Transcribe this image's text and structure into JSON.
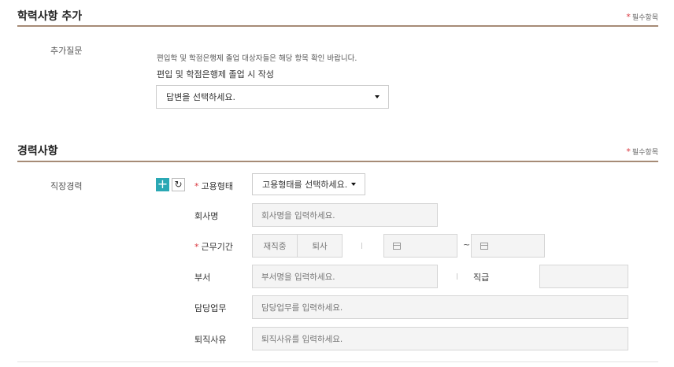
{
  "education": {
    "title": "학력사항 추가",
    "required_note": "필수항목",
    "question_label": "추가질문",
    "help_text": "편입학 및 학점은행제 졸업 대상자들은 해당 항목 확인 바랍니다.",
    "sub_label": "편입 및 학점은행제 졸업 시 작성",
    "answer_select": "답변을 선택하세요."
  },
  "career": {
    "title": "경력사항",
    "required_note": "필수항목",
    "row_label": "직장경력",
    "add_icon": "plus-icon",
    "reset_icon": "refresh-icon",
    "employment_type": {
      "label": "고용형태",
      "select": "고용형태를 선택하세요."
    },
    "company": {
      "label": "회사명",
      "placeholder": "회사명을 입력하세요."
    },
    "period": {
      "label": "근무기간",
      "employed": "재직중",
      "resigned": "퇴사",
      "separator": "~"
    },
    "department": {
      "label": "부서",
      "placeholder": "부서명을 입력하세요."
    },
    "position": {
      "label": "직급"
    },
    "duty": {
      "label": "담당업무",
      "placeholder": "담당업무를 입력하세요."
    },
    "reason": {
      "label": "퇴직사유",
      "placeholder": "퇴직사유를 입력하세요."
    }
  }
}
